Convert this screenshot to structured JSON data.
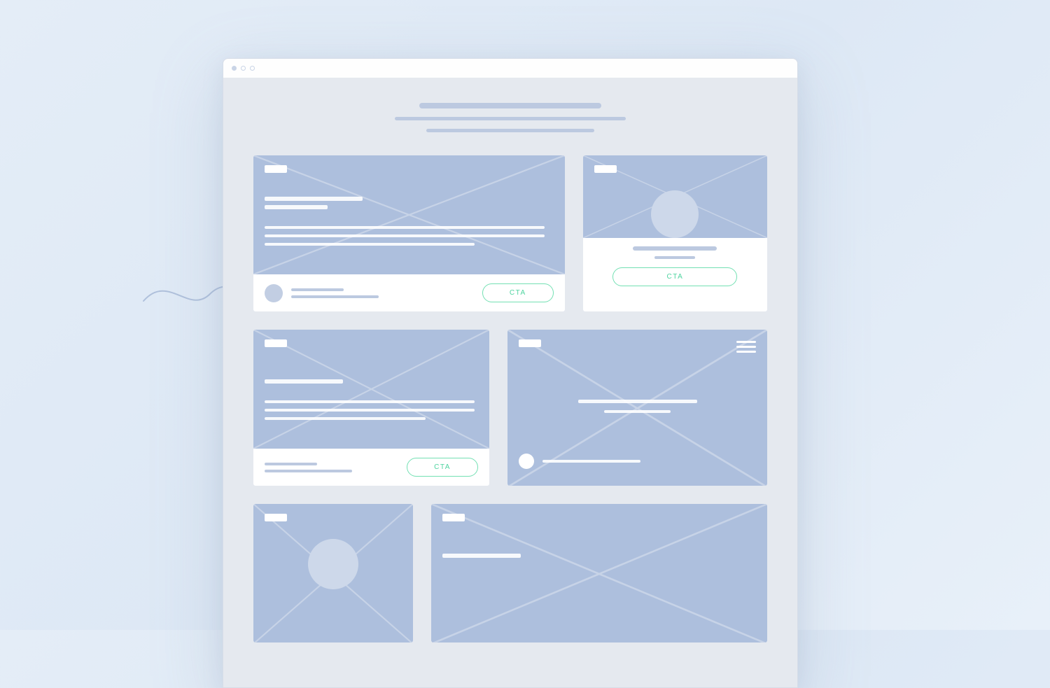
{
  "cta_label": "CTA"
}
